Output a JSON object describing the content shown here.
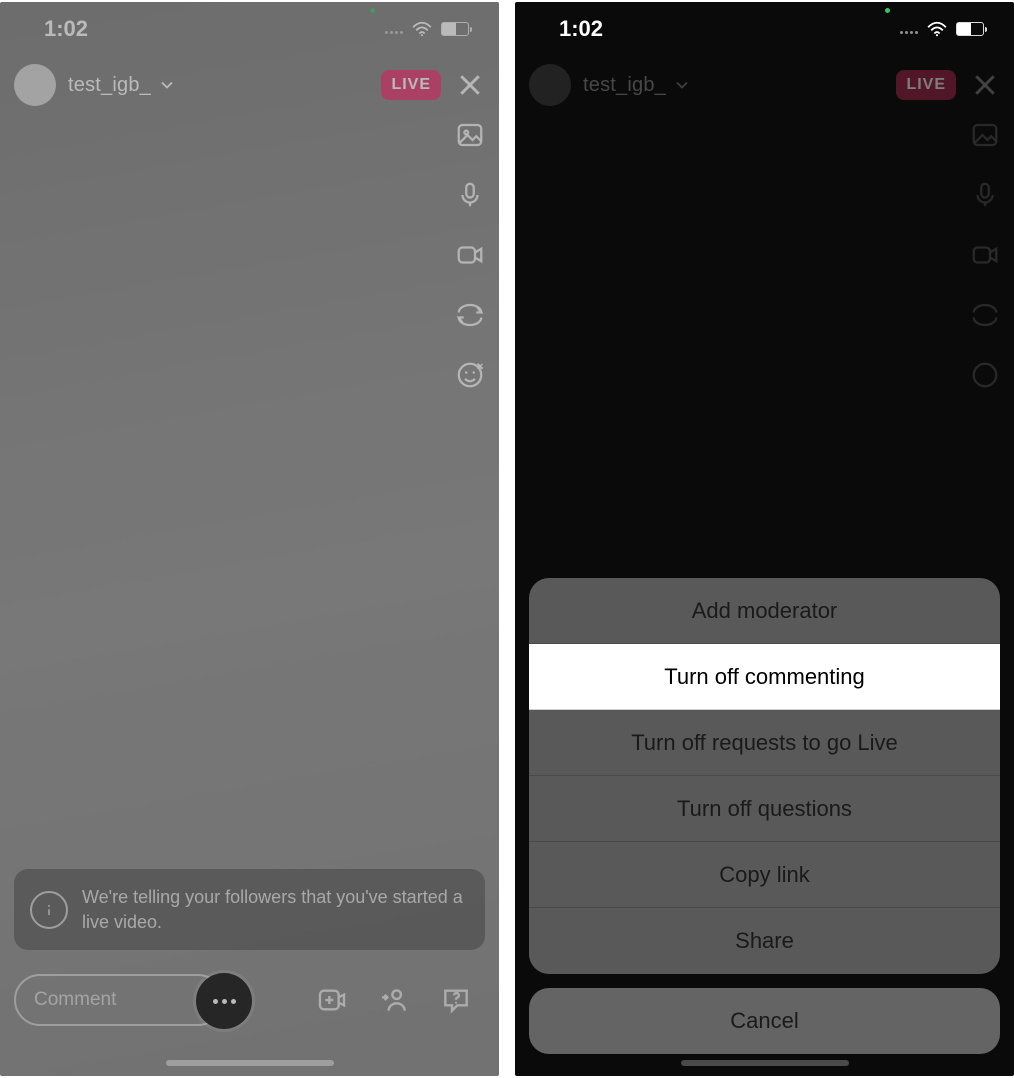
{
  "status": {
    "time": "1:02"
  },
  "header": {
    "username": "test_igb_",
    "live_badge": "LIVE"
  },
  "info": {
    "text": "We're telling your followers that you've started a live video."
  },
  "bottom": {
    "comment_placeholder": "Comment"
  },
  "sheet": {
    "items": [
      "Add moderator",
      "Turn off commenting",
      "Turn off requests to go Live",
      "Turn off questions",
      "Copy link",
      "Share"
    ],
    "highlight_index": 1,
    "cancel": "Cancel"
  }
}
